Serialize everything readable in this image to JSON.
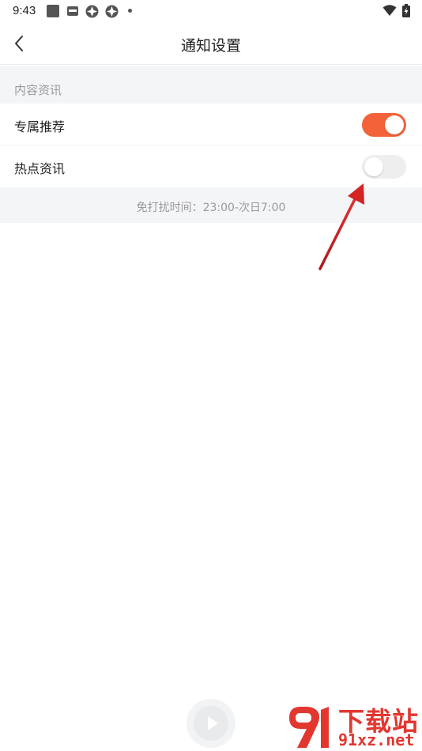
{
  "status_bar": {
    "time": "9:43",
    "icons": [
      "app-square-icon",
      "app-box-icon",
      "clover-icon",
      "clover-icon",
      "dot-icon",
      "wifi-icon",
      "battery-charging-icon"
    ]
  },
  "nav": {
    "title": "通知设置",
    "back_icon": "chevron-left-icon"
  },
  "section": {
    "label": "内容资讯"
  },
  "settings": [
    {
      "label": "专属推荐",
      "enabled": true
    },
    {
      "label": "热点资讯",
      "enabled": false
    }
  ],
  "dnd": {
    "text": "免打扰时间：23:00-次日7:00"
  },
  "colors": {
    "accent": "#f4623a",
    "toggle_off": "#eeeeee",
    "arrow": "#d42424",
    "watermark": "#e2372f",
    "section_bg": "#f4f5f7"
  },
  "watermark": {
    "title": "下载站",
    "url": "91xz.net"
  }
}
